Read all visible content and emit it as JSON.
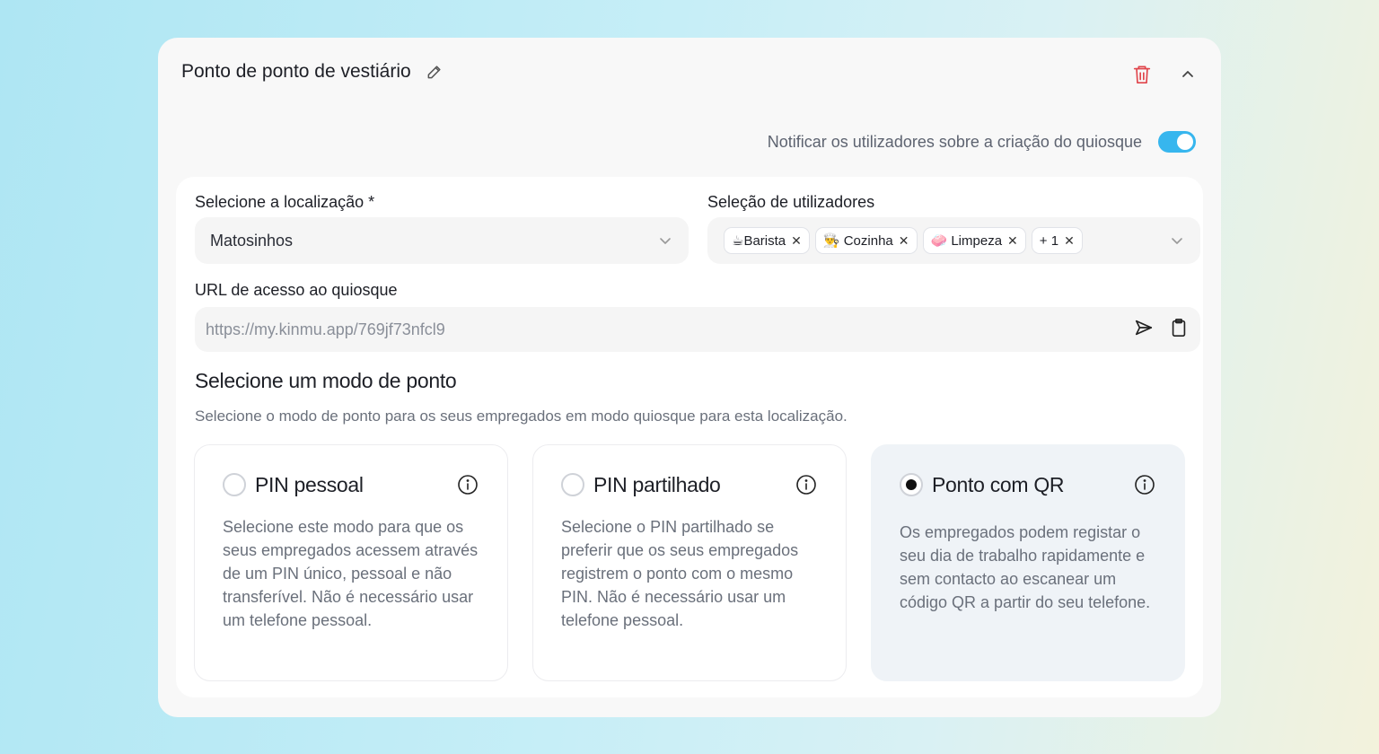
{
  "card": {
    "title": "Ponto de ponto de vestiário",
    "notify_label": "Notificar os utilizadores sobre a criação do quiosque",
    "notify_on": true
  },
  "location": {
    "label": "Selecione a localização *",
    "value": "Matosinhos"
  },
  "users": {
    "label": "Seleção de utilizadores",
    "chips": [
      {
        "label": "☕Barista"
      },
      {
        "label": "👨‍🍳 Cozinha"
      },
      {
        "label": "🧼 Limpeza"
      },
      {
        "label": "+ 1"
      }
    ]
  },
  "url": {
    "label": "URL de acesso ao quiosque",
    "value": "https://my.kinmu.app/769jf73nfcl9"
  },
  "modes": {
    "title": "Selecione um modo de ponto",
    "subtitle": "Selecione o modo de ponto para os seus empregados em modo quiosque para esta localização.",
    "options": [
      {
        "title": "PIN pessoal",
        "description": "Selecione este modo para que os seus empregados acessem através de um PIN único, pessoal e não transferível. Não é necessário usar um telefone pessoal.",
        "selected": false
      },
      {
        "title": "PIN partilhado",
        "description": "Selecione o PIN partilhado se preferir que os seus empregados registrem o ponto com o mesmo PIN. Não é necessário usar um telefone pessoal.",
        "selected": false
      },
      {
        "title": "Ponto com QR",
        "description": "Os empregados podem registar o seu dia de trabalho rapidamente e sem contacto ao escanear um código QR a partir do seu telefone.",
        "selected": true
      }
    ]
  },
  "colors": {
    "accent": "#37b6ee",
    "danger": "#e0444a",
    "selected_card": "#eff3f7"
  }
}
